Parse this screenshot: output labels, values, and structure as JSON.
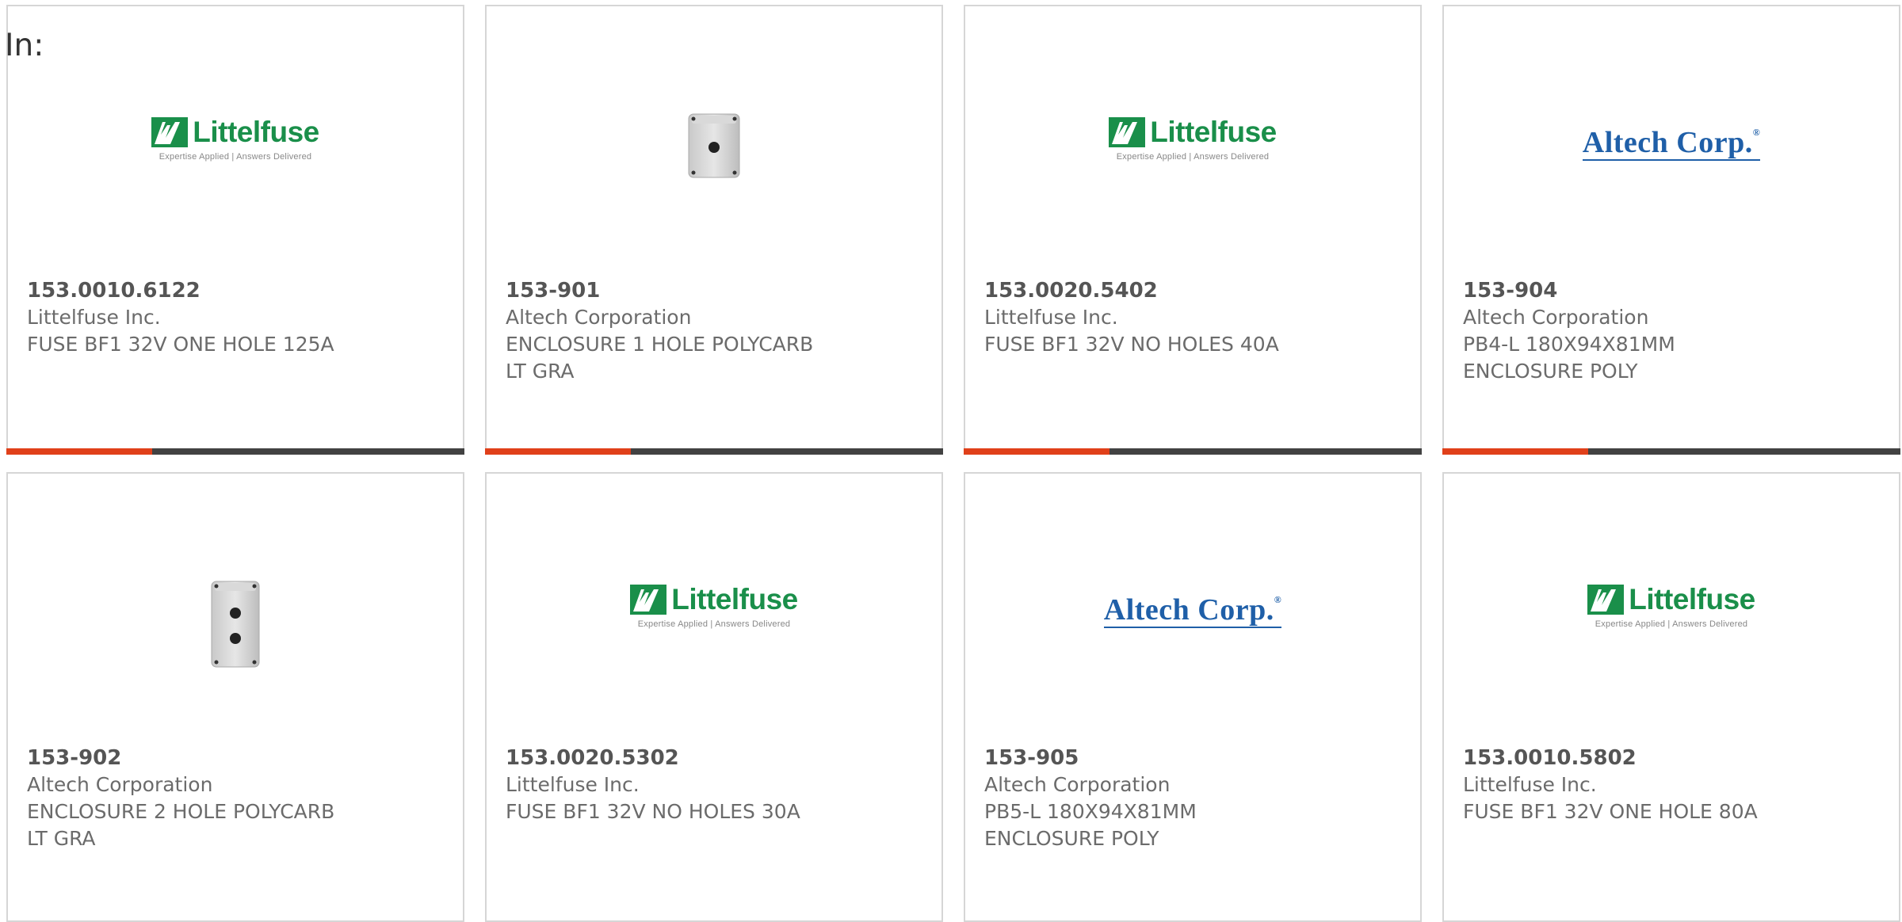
{
  "filter_label": "In:",
  "products": [
    {
      "part": "153.0010.6122",
      "maker": "Littelfuse Inc.",
      "desc1": "FUSE BF1 32V ONE HOLE 125A",
      "desc2": "",
      "image": "littelfuse-logo"
    },
    {
      "part": "153-901",
      "maker": "Altech Corporation",
      "desc1": "ENCLOSURE 1 HOLE POLYCARB",
      "desc2": "LT GRA",
      "image": "enclosure-1-hole"
    },
    {
      "part": "153.0020.5402",
      "maker": "Littelfuse Inc.",
      "desc1": "FUSE BF1 32V NO HOLES 40A",
      "desc2": "",
      "image": "littelfuse-logo"
    },
    {
      "part": "153-904",
      "maker": "Altech Corporation",
      "desc1": "PB4-L 180X94X81MM",
      "desc2": "ENCLOSURE POLY",
      "image": "altech-logo"
    },
    {
      "part": "153-902",
      "maker": "Altech Corporation",
      "desc1": "ENCLOSURE 2 HOLE POLYCARB",
      "desc2": "LT GRA",
      "image": "enclosure-2-hole"
    },
    {
      "part": "153.0020.5302",
      "maker": "Littelfuse Inc.",
      "desc1": "FUSE BF1 32V NO HOLES 30A",
      "desc2": "",
      "image": "littelfuse-logo"
    },
    {
      "part": "153-905",
      "maker": "Altech Corporation",
      "desc1": "PB5-L 180X94X81MM",
      "desc2": "ENCLOSURE POLY",
      "image": "altech-logo"
    },
    {
      "part": "153.0010.5802",
      "maker": "Littelfuse Inc.",
      "desc1": "FUSE BF1 32V ONE HOLE 80A",
      "desc2": "",
      "image": "littelfuse-logo"
    }
  ],
  "logos": {
    "littelfuse_name": "Littelfuse",
    "littelfuse_tagline": "Expertise Applied | Answers Delivered",
    "altech_name": "Altech Corp."
  },
  "colors": {
    "accent": "#e0401a",
    "bar": "#424242",
    "littelfuse_green": "#1a8f4a",
    "altech_blue": "#1f5fa8"
  }
}
